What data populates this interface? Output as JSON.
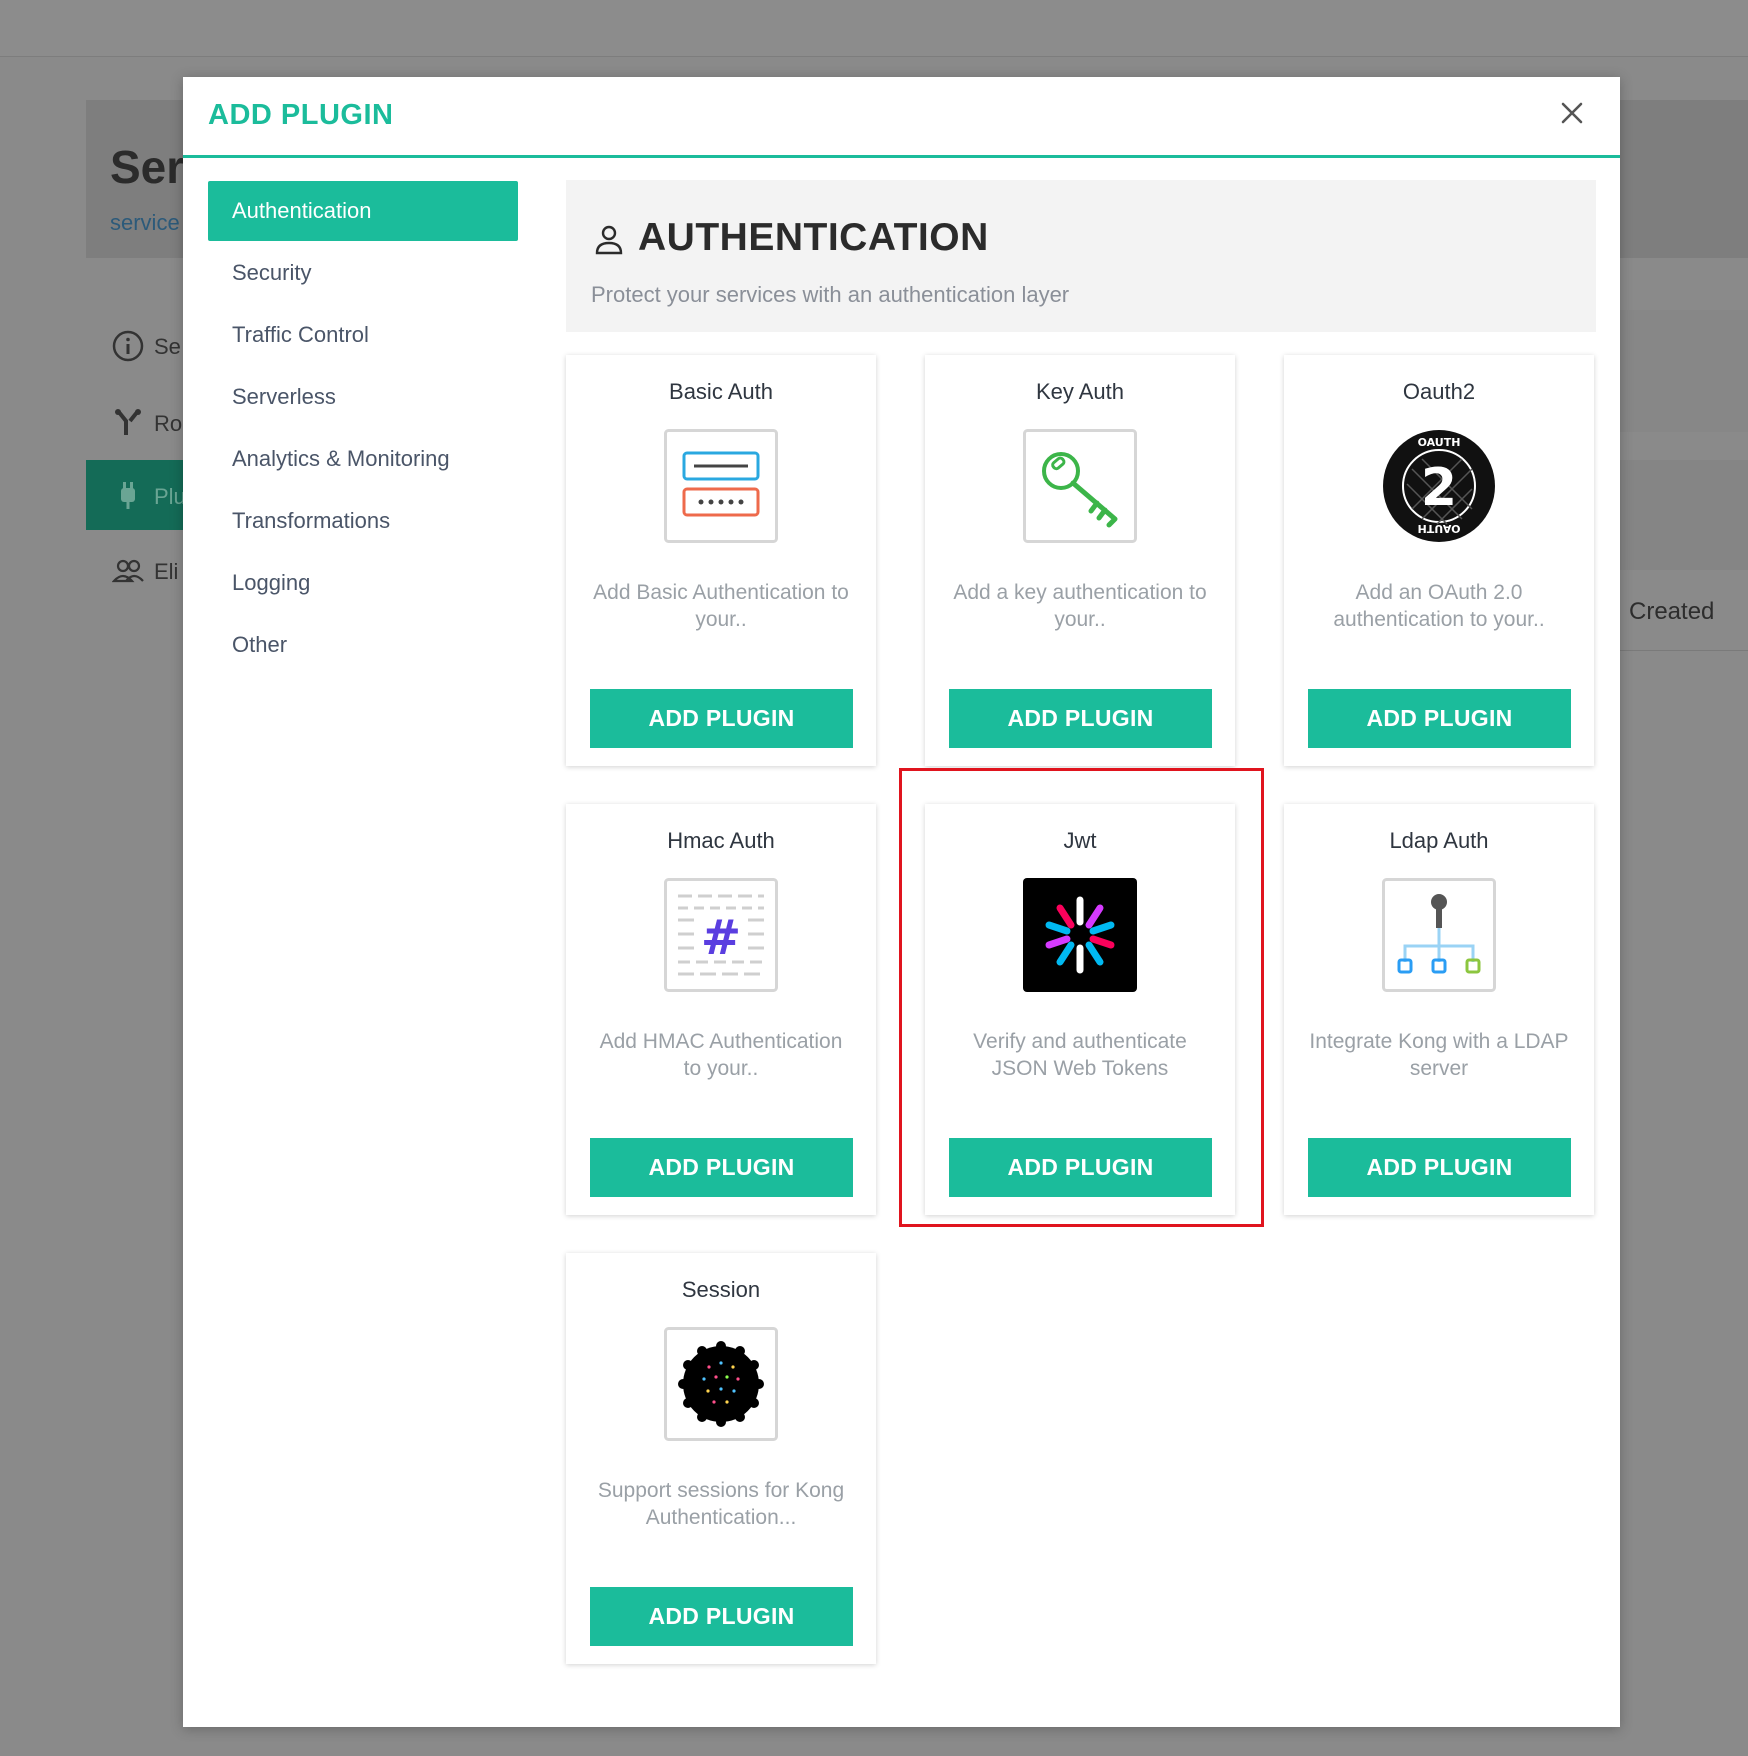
{
  "background": {
    "page_title": "Ser",
    "page_subtitle": "service",
    "nav": [
      {
        "label": "Se",
        "icon": "info-icon"
      },
      {
        "label": "Ro",
        "icon": "routes-icon"
      },
      {
        "label": "Plu",
        "icon": "plug-icon"
      },
      {
        "label": "Eli",
        "icon": "users-icon"
      }
    ],
    "table_header_created": "Created"
  },
  "modal": {
    "title": "ADD PLUGIN",
    "close_icon": "close-icon"
  },
  "sidebar": {
    "items": [
      {
        "label": "Authentication",
        "active": true
      },
      {
        "label": "Security"
      },
      {
        "label": "Traffic Control"
      },
      {
        "label": "Serverless"
      },
      {
        "label": "Analytics & Monitoring"
      },
      {
        "label": "Transformations"
      },
      {
        "label": "Logging"
      },
      {
        "label": "Other"
      }
    ]
  },
  "category": {
    "icon": "user-icon",
    "title": "AUTHENTICATION",
    "description": "Protect your services with an authentication layer"
  },
  "plugins": [
    {
      "name": "Basic Auth",
      "icon": "basic-auth-icon",
      "description": "Add Basic Authentication to your..",
      "button": "ADD PLUGIN"
    },
    {
      "name": "Key Auth",
      "icon": "key-icon",
      "description": "Add a key authentication to your..",
      "button": "ADD PLUGIN"
    },
    {
      "name": "Oauth2",
      "icon": "oauth2-icon",
      "description": "Add an OAuth 2.0 authentication to your..",
      "button": "ADD PLUGIN"
    },
    {
      "name": "Hmac Auth",
      "icon": "hmac-icon",
      "description": "Add HMAC Authentication to your..",
      "button": "ADD PLUGIN"
    },
    {
      "name": "Jwt",
      "icon": "jwt-icon",
      "description": "Verify and authenticate JSON Web Tokens",
      "button": "ADD PLUGIN",
      "highlighted": true
    },
    {
      "name": "Ldap Auth",
      "icon": "ldap-icon",
      "description": "Integrate Kong with a LDAP server",
      "button": "ADD PLUGIN"
    },
    {
      "name": "Session",
      "icon": "cookie-icon",
      "description": "Support sessions for Kong Authentication...",
      "button": "ADD PLUGIN"
    }
  ],
  "colors": {
    "accent": "#1bbc9b",
    "highlight": "#e0141e"
  }
}
